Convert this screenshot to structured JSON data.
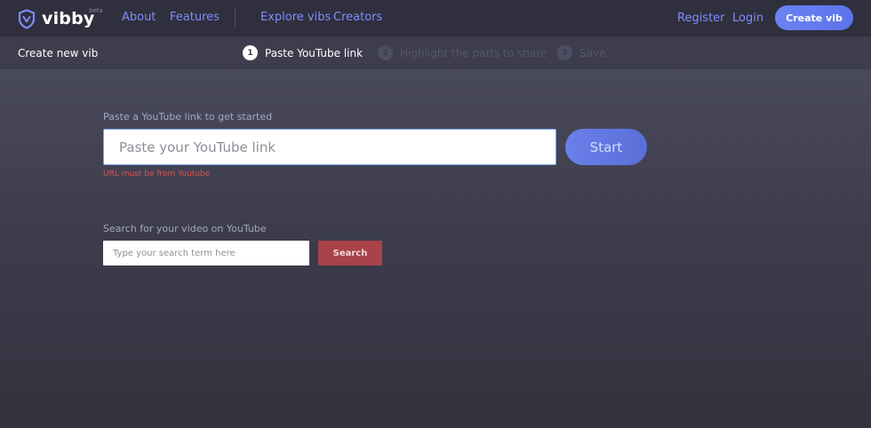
{
  "header": {
    "logo_text": "vibby",
    "logo_badge": "beta",
    "nav": {
      "about": "About",
      "features": "Features",
      "explore": "Explore vibs",
      "creators": "Creators"
    },
    "register": "Register",
    "login": "Login",
    "create_button": "Create vib",
    "accent_color": "#7f8cff"
  },
  "steps_bar": {
    "page_title": "Create new vib",
    "steps": [
      {
        "number": "1",
        "label": "Paste YouTube link",
        "state": "active"
      },
      {
        "number": "2",
        "label": "Highlight the parts to share",
        "state": "inactive"
      },
      {
        "number": "3",
        "label": "Save",
        "state": "inactive"
      }
    ]
  },
  "main": {
    "url_label": "Paste a YouTube link to get started",
    "url_placeholder": "Paste your YouTube link",
    "url_value": "",
    "start_button": "Start",
    "url_error": "URL must be from Youtube",
    "search_label": "Search for your video on YouTube",
    "search_placeholder": "Type your search term here",
    "search_value": "",
    "search_button": "Search",
    "error_color": "#d9534f"
  }
}
